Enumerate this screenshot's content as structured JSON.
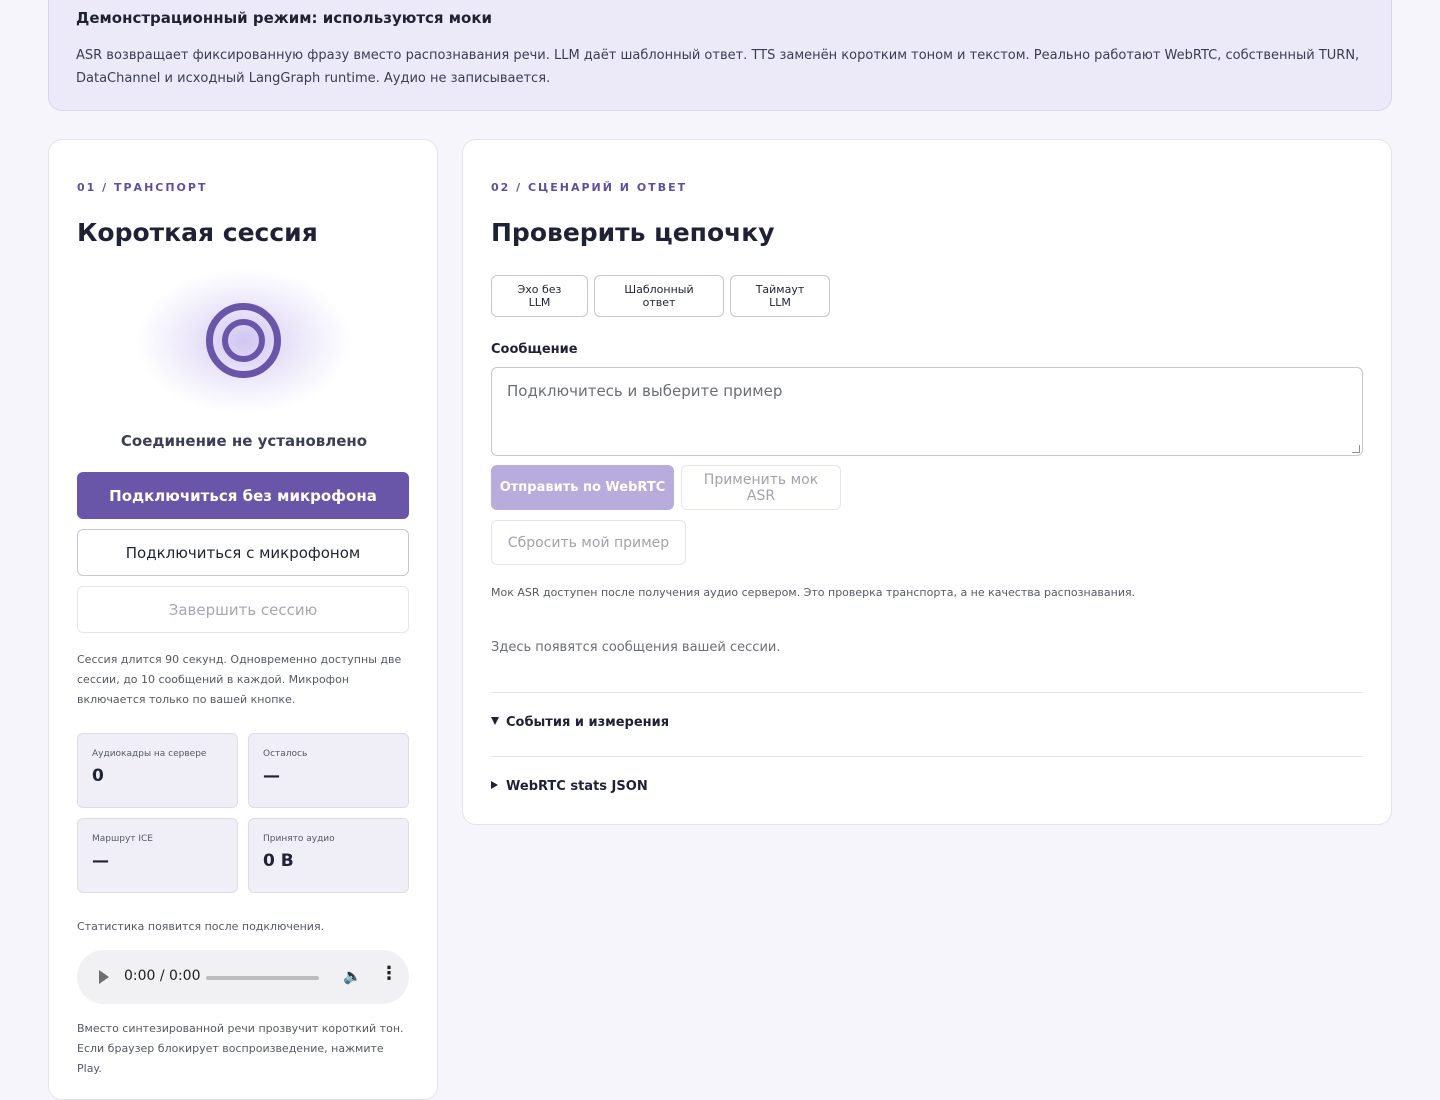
{
  "banner": {
    "title": "Демонстрационный режим: используются моки",
    "text": "ASR возвращает фиксированную фразу вместо распознавания речи. LLM даёт шаблонный ответ. TTS заменён коротким тоном и текстом. Реально работают WebRTC, собственный TURN, DataChannel и исходный LangGraph runtime. Аудио не записывается."
  },
  "transport": {
    "eyebrow": "01 / ТРАНСПОРТ",
    "title": "Короткая сессия",
    "status": "Соединение не установлено",
    "connect_no_mic": "Подключиться без микрофона",
    "connect_mic": "Подключиться с микрофоном",
    "end_session": "Завершить сессию",
    "session_note": "Сессия длится 90 секунд. Одновременно доступны две сессии, до 10 сообщений в каждой. Микрофон включается только по вашей кнопке.",
    "stats": [
      {
        "label": "Аудиокадры на сервере",
        "value": "0"
      },
      {
        "label": "Осталось",
        "value": "—"
      },
      {
        "label": "Маршрут ICE",
        "value": "—"
      },
      {
        "label": "Принято аудио",
        "value": "0 B"
      }
    ],
    "stats_note": "Статистика появится после подключения.",
    "audio_time": "0:00 / 0:00",
    "audio_note": "Вместо синтезированной речи прозвучит короткий тон. Если браузер блокирует воспроизведение, нажмите Play."
  },
  "scenario": {
    "eyebrow": "02 / СЦЕНАРИЙ И ОТВЕТ",
    "title": "Проверить цепочку",
    "chips": [
      "Эхо без LLM",
      "Шаблонный ответ",
      "Таймаут LLM"
    ],
    "message_label": "Сообщение",
    "message_placeholder": "Подключитесь и выберите пример",
    "send": "Отправить по WebRTC",
    "apply_asr": "Применить мок ASR",
    "reset": "Сбросить мой пример",
    "hint": "Мок ASR доступен после получения аудио сервером. Это проверка транспорта, а не качества распознавания.",
    "empty": "Здесь появятся сообщения вашей сессии.",
    "events_summary": "События и измерения",
    "stats_summary": "WebRTC stats JSON"
  },
  "colors": {
    "accent": "#6a56a8",
    "accent_disabled": "#b7acdc",
    "banner_bg": "#eceaf8",
    "page_bg": "#f6f5fb"
  }
}
